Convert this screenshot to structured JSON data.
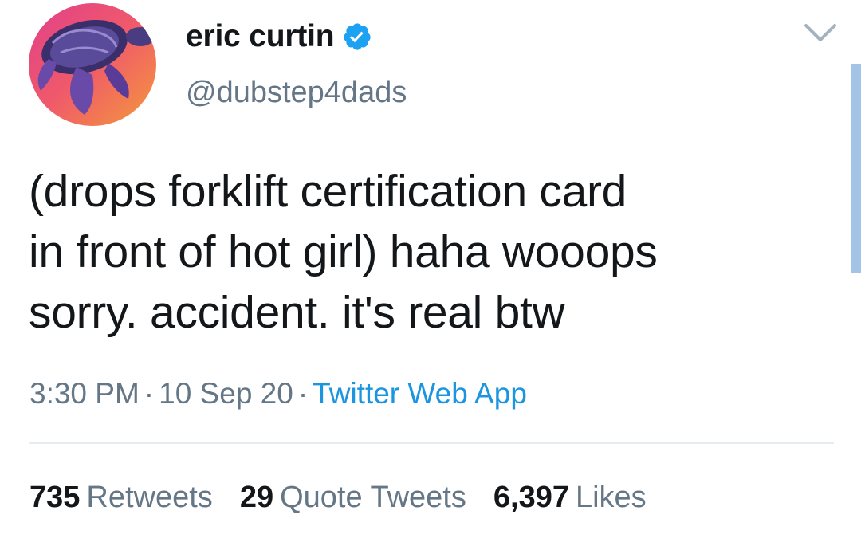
{
  "user": {
    "display_name": "eric curtin",
    "handle": "@dubstep4dads",
    "verified": true,
    "avatar_icon": "sea-turtle-avatar"
  },
  "tweet": {
    "text": "(drops forklift certification card\nin front of hot girl) haha wooops\nsorry. accident. it's real btw",
    "time": "3:30 PM",
    "date": "10 Sep 20",
    "source": "Twitter Web App",
    "separator": "·"
  },
  "stats": [
    {
      "count": "735",
      "label": "Retweets"
    },
    {
      "count": "29",
      "label": "Quote Tweets"
    },
    {
      "count": "6,397",
      "label": "Likes"
    }
  ],
  "icons": {
    "verified": "verified-badge-icon",
    "menu": "chevron-down-icon"
  },
  "colors": {
    "accent": "#1da1f2",
    "link": "#1b95e0",
    "secondary_text": "#657786",
    "primary_text": "#14171a"
  }
}
